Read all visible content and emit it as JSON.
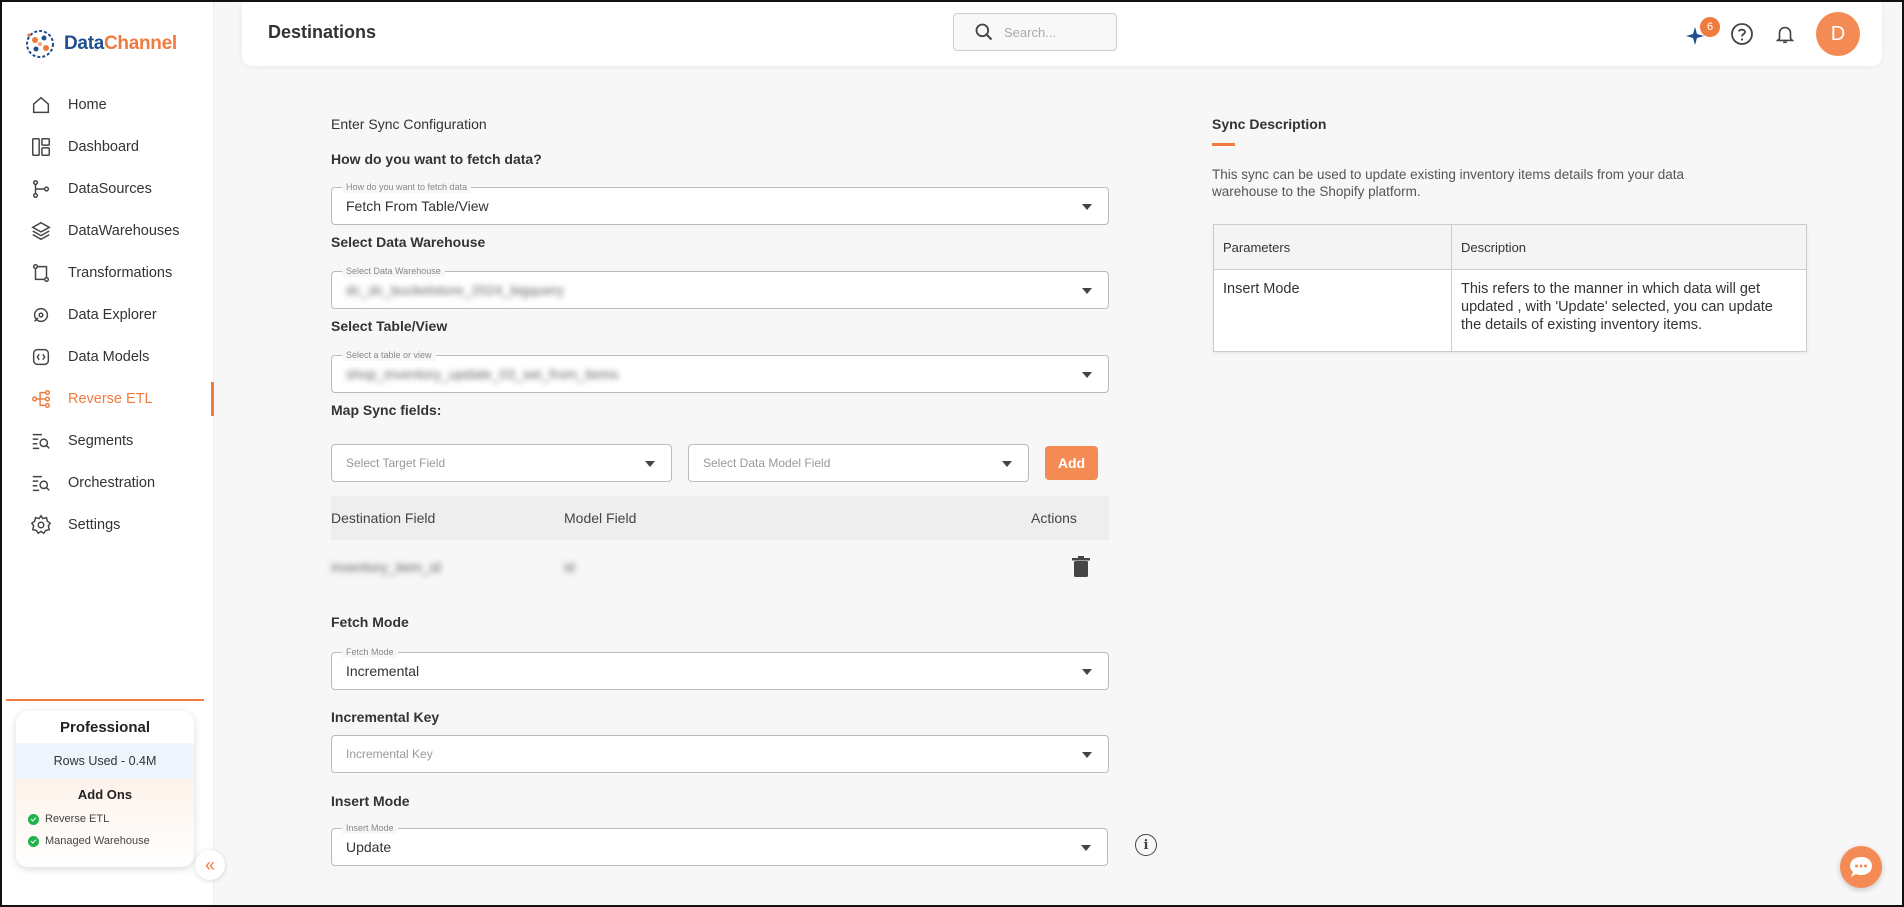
{
  "brand": {
    "part1": "Data",
    "part2": "Channel"
  },
  "sidebar": {
    "items": [
      {
        "label": "Home",
        "icon": "home-icon"
      },
      {
        "label": "Dashboard",
        "icon": "dashboard-icon"
      },
      {
        "label": "DataSources",
        "icon": "datasources-icon"
      },
      {
        "label": "DataWarehouses",
        "icon": "datawarehouses-icon"
      },
      {
        "label": "Transformations",
        "icon": "transformations-icon"
      },
      {
        "label": "Data Explorer",
        "icon": "data-explorer-icon"
      },
      {
        "label": "Data Models",
        "icon": "data-models-icon"
      },
      {
        "label": "Reverse ETL",
        "icon": "reverse-etl-icon",
        "active": true
      },
      {
        "label": "Segments",
        "icon": "segments-icon"
      },
      {
        "label": "Orchestration",
        "icon": "orchestration-icon"
      },
      {
        "label": "Settings",
        "icon": "settings-icon"
      }
    ],
    "plan": {
      "name": "Professional",
      "rows_used": "Rows Used - 0.4M",
      "addons_title": "Add Ons",
      "addons": [
        "Reverse ETL",
        "Managed Warehouse"
      ]
    }
  },
  "header": {
    "title": "Destinations",
    "search_placeholder": "Search...",
    "notification_count": "6",
    "avatar_initial": "D"
  },
  "form": {
    "section_title": "Enter Sync Configuration",
    "fetch_question": "How do you want to fetch data?",
    "fetch_legend": "How do you want to fetch data",
    "fetch_value": "Fetch From Table/View",
    "warehouse_label": "Select Data Warehouse",
    "warehouse_legend": "Select Data Warehouse",
    "warehouse_value": "dc_dc_bucketstore_2024_bigquery",
    "table_label": "Select Table/View",
    "table_legend": "Select a table or view",
    "table_value": "shop_inventory_update_03_set_from_items",
    "map_label": "Map Sync fields:",
    "target_placeholder": "Select Target Field",
    "model_placeholder": "Select Data Model Field",
    "add_label": "Add",
    "map_table": {
      "headers": [
        "Destination Field",
        "Model Field",
        "Actions"
      ],
      "rows": [
        {
          "destination": "inventory_item_id",
          "model": "id"
        }
      ]
    },
    "fetch_mode_label": "Fetch Mode",
    "fetch_mode_legend": "Fetch Mode",
    "fetch_mode_value": "Incremental",
    "incremental_key_label": "Incremental Key",
    "incremental_key_placeholder": "Incremental Key",
    "insert_mode_label": "Insert Mode",
    "insert_mode_legend": "Insert Mode",
    "insert_mode_value": "Update"
  },
  "sync": {
    "title": "Sync Description",
    "description": "This sync can be used to update existing inventory items details from your data warehouse to the Shopify platform.",
    "table_headers": [
      "Parameters",
      "Description"
    ],
    "rows": [
      {
        "parameter": "Insert Mode",
        "description": "This refers to the manner in which data will get updated , with 'Update' selected, you can update the details of existing inventory items."
      }
    ]
  },
  "colors": {
    "accent": "#f07b3f",
    "brand_blue": "#1f4f8f"
  }
}
